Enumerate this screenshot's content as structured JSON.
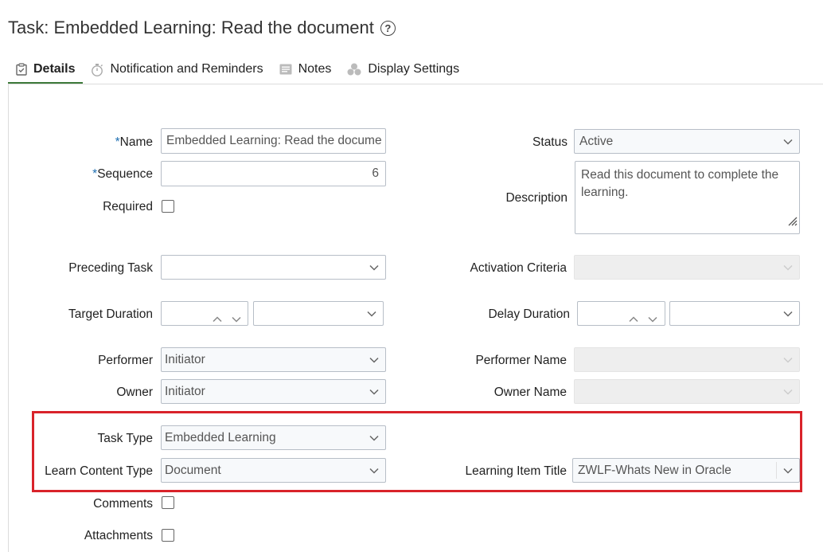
{
  "page": {
    "title": "Task: Embedded Learning: Read the document"
  },
  "tabs": [
    {
      "label": "Details",
      "icon": "clipboard-icon",
      "active": true
    },
    {
      "label": "Notification and Reminders",
      "icon": "stopwatch-icon",
      "active": false
    },
    {
      "label": "Notes",
      "icon": "note-icon",
      "active": false
    },
    {
      "label": "Display Settings",
      "icon": "display-settings-icon",
      "active": false
    }
  ],
  "form": {
    "name": {
      "label": "Name",
      "required_mark": "*",
      "value": "Embedded Learning: Read the docume"
    },
    "sequence": {
      "label": "Sequence",
      "required_mark": "*",
      "value": "6"
    },
    "required": {
      "label": "Required",
      "checked": false
    },
    "status": {
      "label": "Status",
      "value": "Active"
    },
    "description": {
      "label": "Description",
      "value": "Read this document to complete the learning."
    },
    "preceding_task": {
      "label": "Preceding Task",
      "value": ""
    },
    "activation_criteria": {
      "label": "Activation Criteria",
      "value": ""
    },
    "target_duration": {
      "label": "Target Duration",
      "value": "",
      "unit": ""
    },
    "delay_duration": {
      "label": "Delay Duration",
      "value": "",
      "unit": ""
    },
    "performer": {
      "label": "Performer",
      "value": "Initiator"
    },
    "performer_name": {
      "label": "Performer Name",
      "value": ""
    },
    "owner": {
      "label": "Owner",
      "value": "Initiator"
    },
    "owner_name": {
      "label": "Owner Name",
      "value": ""
    },
    "task_type": {
      "label": "Task Type",
      "value": "Embedded Learning"
    },
    "learn_content_type": {
      "label": "Learn Content Type",
      "value": "Document"
    },
    "learning_item_title": {
      "label": "Learning Item Title",
      "value": "ZWLF-Whats New in Oracle"
    },
    "comments": {
      "label": "Comments",
      "checked": false
    },
    "attachments": {
      "label": "Attachments",
      "checked": false
    }
  },
  "colors": {
    "accent": "#3d7a3a",
    "highlight": "#d9232a",
    "required": "#1f6fb2"
  }
}
